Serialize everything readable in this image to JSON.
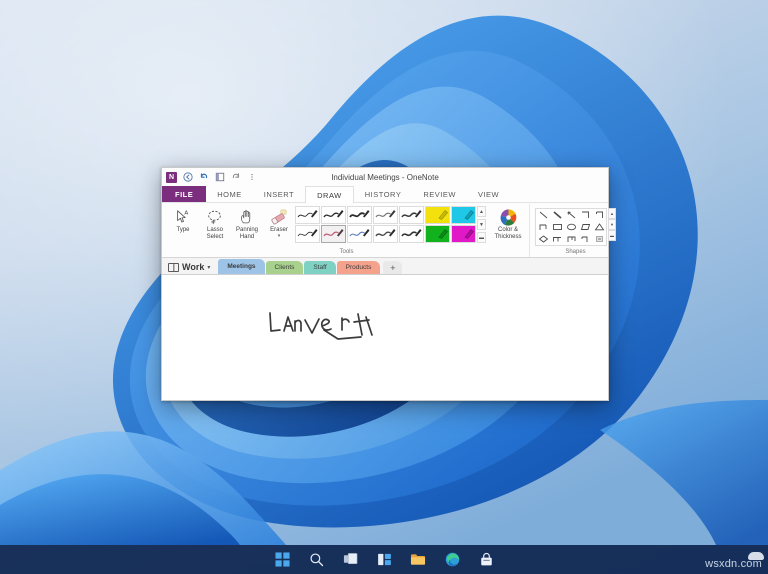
{
  "desktop": {
    "wallpaper_name": "windows-11-bloom-wallpaper",
    "background_colors": [
      "#cfdced",
      "#9dc0e0",
      "#1b7ae0",
      "#0b5bc4"
    ],
    "watermark": "wsxdn.com"
  },
  "taskbar": {
    "items": [
      {
        "name": "start-button",
        "icon": "windows-logo-icon",
        "label": "Start"
      },
      {
        "name": "search-button",
        "icon": "search-icon",
        "label": "Search"
      },
      {
        "name": "task-view-button",
        "icon": "task-view-icon",
        "label": "Task View"
      },
      {
        "name": "widgets-button",
        "icon": "widgets-icon",
        "label": "Widgets"
      },
      {
        "name": "file-explorer-button",
        "icon": "folder-icon",
        "label": "File Explorer"
      },
      {
        "name": "edge-button",
        "icon": "edge-browser-icon",
        "label": "Microsoft Edge"
      },
      {
        "name": "store-button",
        "icon": "store-bag-icon",
        "label": "Microsoft Store"
      }
    ]
  },
  "window": {
    "title": "Individual Meetings - OneNote",
    "app_accent": "#7b2e7e",
    "quick_access": [
      {
        "name": "app-logo",
        "icon": "onenote-logo-icon",
        "label": "N"
      },
      {
        "name": "back-button",
        "icon": "back-circle-icon",
        "label": "Back"
      },
      {
        "name": "undo-button",
        "icon": "undo-icon",
        "label": "Undo"
      },
      {
        "name": "dock-button",
        "icon": "dock-to-desktop-icon",
        "label": "Dock to Desktop"
      },
      {
        "name": "redo-button",
        "icon": "redo-icon",
        "label": "Redo"
      },
      {
        "name": "customize-qat-button",
        "icon": "ellipsis-vertical-icon",
        "label": "⋮"
      }
    ],
    "ribbon_tabs": [
      {
        "label": "FILE",
        "kind": "file",
        "active": false
      },
      {
        "label": "HOME",
        "kind": "normal",
        "active": false
      },
      {
        "label": "INSERT",
        "kind": "normal",
        "active": false
      },
      {
        "label": "DRAW",
        "kind": "normal",
        "active": true
      },
      {
        "label": "HISTORY",
        "kind": "normal",
        "active": false
      },
      {
        "label": "REVIEW",
        "kind": "normal",
        "active": false
      },
      {
        "label": "VIEW",
        "kind": "normal",
        "active": false
      }
    ]
  },
  "ribbon": {
    "tools_group": {
      "label": "Tools",
      "buttons": [
        {
          "name": "type-tool",
          "caption": "Type",
          "icon": "cursor-text-icon",
          "has_caret": false
        },
        {
          "name": "lasso-select-tool",
          "caption": "Lasso\nSelect",
          "icon": "lasso-icon",
          "has_caret": false
        },
        {
          "name": "panning-hand-tool",
          "caption": "Panning\nHand",
          "icon": "hand-icon",
          "has_caret": false
        },
        {
          "name": "eraser-tool",
          "caption": "Eraser",
          "icon": "eraser-icon",
          "has_caret": true
        }
      ],
      "pens": [
        {
          "name": "pen-black-thin",
          "type": "pen",
          "color": "#2b2b2b",
          "selected": false
        },
        {
          "name": "pen-black-medium",
          "type": "pen",
          "color": "#2b2b2b",
          "selected": false
        },
        {
          "name": "pen-black-bold",
          "type": "pen",
          "color": "#2b2b2b",
          "selected": false
        },
        {
          "name": "pen-gray",
          "type": "pen",
          "color": "#6e6e6e",
          "selected": false
        },
        {
          "name": "pen-charcoal",
          "type": "pen",
          "color": "#3a3a3a",
          "selected": false
        },
        {
          "name": "highlighter-yellow",
          "type": "highlighter",
          "color": "#f2e10c",
          "selected": false
        },
        {
          "name": "highlighter-cyan",
          "type": "highlighter",
          "color": "#1ec8e6",
          "selected": false
        },
        {
          "name": "pen-black-fine",
          "type": "pen",
          "color": "#2b2b2b",
          "selected": false
        },
        {
          "name": "pen-red",
          "type": "pen",
          "color": "#c05a74",
          "selected": true
        },
        {
          "name": "pen-blue",
          "type": "pen",
          "color": "#5a7fc0",
          "selected": false
        },
        {
          "name": "pen-slate",
          "type": "pen",
          "color": "#4a4a4a",
          "selected": false
        },
        {
          "name": "pen-dark",
          "type": "pen",
          "color": "#333333",
          "selected": false
        },
        {
          "name": "highlighter-green",
          "type": "highlighter",
          "color": "#12b21e",
          "selected": false
        },
        {
          "name": "highlighter-magenta",
          "type": "highlighter",
          "color": "#e018c8",
          "selected": false
        }
      ],
      "gallery_scroll": {
        "up": "▲",
        "down": "▼",
        "more": "▬"
      },
      "color_thickness": {
        "name": "color-thickness-button",
        "caption": "Color &\nThickness",
        "icon": "color-wheel-icon"
      }
    },
    "shapes_group": {
      "label": "Shapes",
      "shapes": [
        "line-diagonal",
        "line-diagonal-thick",
        "line-arrow-diagonal",
        "line-corner-right",
        "line-corner-down",
        "line-elbow",
        "rectangle",
        "ellipse",
        "parallelogram",
        "triangle",
        "diamond",
        "polyline",
        "curve-branch",
        "connector-elbow",
        "scroll-handle"
      ],
      "scroll": {
        "up": "▲",
        "down": "▼",
        "more": "▬"
      }
    }
  },
  "notebook": {
    "name": "Work",
    "caret": "▾",
    "sections": [
      {
        "label": "Meetings",
        "color": "#9dc3e6",
        "active": true
      },
      {
        "label": "Clients",
        "color": "#a9d18e",
        "active": false
      },
      {
        "label": "Staff",
        "color": "#7fd1c4",
        "active": false
      },
      {
        "label": "Products",
        "color": "#f4a28c",
        "active": false
      }
    ],
    "add_section_label": "+"
  },
  "page": {
    "ink_note": "handwritten ink stroke reading 'convert'",
    "ink_color": "#3c3c3c"
  }
}
